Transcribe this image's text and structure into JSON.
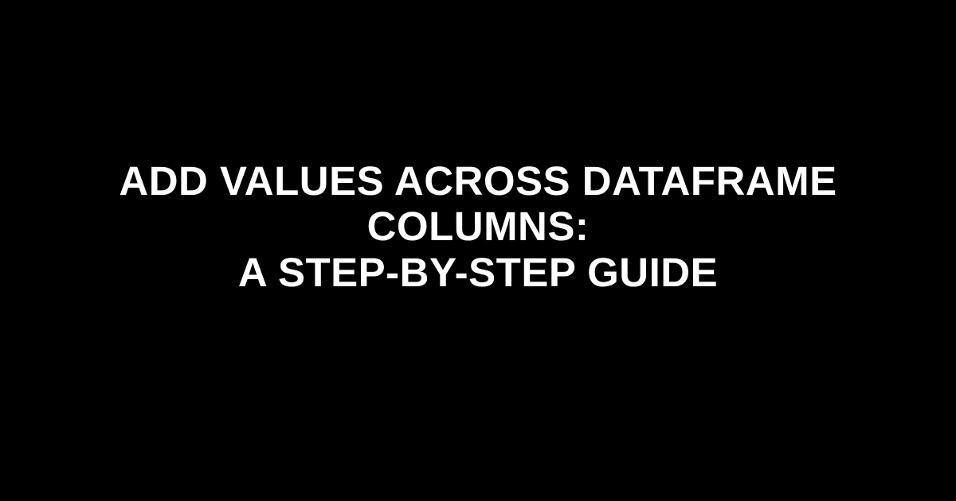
{
  "title": {
    "line1": "ADD VALUES ACROSS DATAFRAME COLUMNS:",
    "line2": "A STEP-BY-STEP GUIDE"
  }
}
